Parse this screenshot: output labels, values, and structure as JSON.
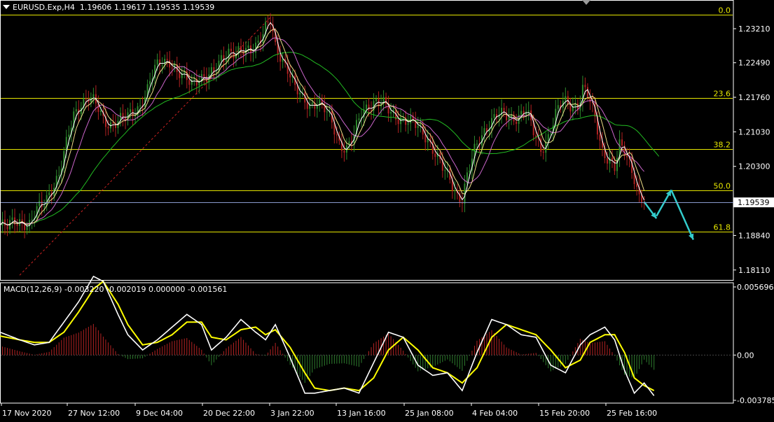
{
  "header": {
    "symbol": "EURUSD.Exp,H4",
    "ohlc": "1.19606 1.19617 1.19535 1.19539"
  },
  "macd_header": "MACD(12,26,9) -0.003220 -0.002019 0.000000 -0.001561",
  "colors": {
    "background": "#000000",
    "axis": "#ffffff",
    "fib": "#e6e600",
    "fib_label": "#e6e600",
    "bull": "#2e8b2e",
    "bear": "#b22222",
    "ma_fast": "#ffffff",
    "ma_mid": "#eedd88",
    "ma_slow": "#cc66cc",
    "ma_long": "#22bb22",
    "macd_line": "#ffffff",
    "signal_line": "#ffff00",
    "hist_pos": "#b22222",
    "hist_neg": "#2e7d2e",
    "arrow": "#33cccc",
    "price_marker_line": "#8899cc",
    "trend": "#cc2222"
  },
  "chart_data": [
    {
      "type": "line",
      "title": "EURUSD.Exp,H4",
      "price_ticks": [
        "1.23210",
        "1.22490",
        "1.21760",
        "1.21030",
        "1.20300",
        "1.19539",
        "1.18840",
        "1.18110"
      ],
      "price_tick_values": [
        1.2321,
        1.2249,
        1.2176,
        1.2103,
        1.203,
        1.19539,
        1.1884,
        1.1811
      ],
      "current_price": "1.19539",
      "x_labels": [
        "17 Nov 2020",
        "27 Nov 12:00",
        "9 Dec 04:00",
        "20 Dec 22:00",
        "3 Jan 22:00",
        "13 Jan 16:00",
        "25 Jan 08:00",
        "4 Feb 04:00",
        "15 Feb 20:00",
        "25 Feb 16:00"
      ],
      "fibonacci": [
        {
          "level": "0.0",
          "price": 1.235
        },
        {
          "level": "23.6",
          "price": 1.2175
        },
        {
          "level": "38.2",
          "price": 1.2067
        },
        {
          "level": "50.0",
          "price": 1.198
        },
        {
          "level": "61.8",
          "price": 1.1892
        }
      ],
      "price_path": [
        [
          0,
          1.1905
        ],
        [
          3,
          1.19
        ],
        [
          6,
          1.1915
        ],
        [
          9,
          1.1915
        ],
        [
          12,
          1.1905
        ],
        [
          15,
          1.1935
        ],
        [
          18,
          1.1955
        ],
        [
          21,
          1.1985
        ],
        [
          24,
          1.201
        ],
        [
          27,
          1.2075
        ],
        [
          30,
          1.214
        ],
        [
          33,
          1.2165
        ],
        [
          36,
          1.2175
        ],
        [
          39,
          1.216
        ],
        [
          42,
          1.213
        ],
        [
          45,
          1.212
        ],
        [
          48,
          1.2125
        ],
        [
          51,
          1.213
        ],
        [
          54,
          1.2145
        ],
        [
          57,
          1.216
        ],
        [
          60,
          1.219
        ],
        [
          63,
          1.2235
        ],
        [
          66,
          1.2255
        ],
        [
          69,
          1.2255
        ],
        [
          72,
          1.2225
        ],
        [
          75,
          1.2215
        ],
        [
          78,
          1.221
        ],
        [
          81,
          1.222
        ],
        [
          84,
          1.2215
        ],
        [
          87,
          1.2225
        ],
        [
          90,
          1.226
        ],
        [
          93,
          1.2275
        ],
        [
          96,
          1.2265
        ],
        [
          99,
          1.227
        ],
        [
          102,
          1.228
        ],
        [
          105,
          1.2295
        ],
        [
          108,
          1.232
        ],
        [
          110,
          1.2335
        ],
        [
          112,
          1.228
        ],
        [
          114,
          1.2265
        ],
        [
          117,
          1.224
        ],
        [
          120,
          1.2195
        ],
        [
          123,
          1.217
        ],
        [
          126,
          1.216
        ],
        [
          129,
          1.217
        ],
        [
          132,
          1.215
        ],
        [
          135,
          1.212
        ],
        [
          138,
          1.208
        ],
        [
          141,
          1.207
        ],
        [
          144,
          1.2095
        ],
        [
          147,
          1.214
        ],
        [
          150,
          1.216
        ],
        [
          153,
          1.217
        ],
        [
          156,
          1.216
        ],
        [
          159,
          1.214
        ],
        [
          162,
          1.2135
        ],
        [
          165,
          1.213
        ],
        [
          168,
          1.212
        ],
        [
          171,
          1.2105
        ],
        [
          174,
          1.209
        ],
        [
          177,
          1.206
        ],
        [
          180,
          1.2025
        ],
        [
          183,
          1.2
        ],
        [
          186,
          1.197
        ],
        [
          188,
          1.1965
        ],
        [
          190,
          1.201
        ],
        [
          193,
          1.206
        ],
        [
          196,
          1.2095
        ],
        [
          199,
          1.2125
        ],
        [
          202,
          1.214
        ],
        [
          205,
          1.2135
        ],
        [
          208,
          1.213
        ],
        [
          211,
          1.214
        ],
        [
          214,
          1.215
        ],
        [
          217,
          1.21
        ],
        [
          220,
          1.2065
        ],
        [
          223,
          1.2095
        ],
        [
          226,
          1.214
        ],
        [
          229,
          1.2165
        ],
        [
          232,
          1.216
        ],
        [
          235,
          1.216
        ],
        [
          237,
          1.2195
        ],
        [
          239,
          1.218
        ],
        [
          242,
          1.213
        ],
        [
          245,
          1.2065
        ],
        [
          248,
          1.2045
        ],
        [
          250,
          1.2025
        ],
        [
          252,
          1.207
        ],
        [
          254,
          1.206
        ],
        [
          256,
          1.204
        ],
        [
          258,
          1.201
        ],
        [
          260,
          1.1965
        ],
        [
          262,
          1.1955
        ]
      ],
      "projection_arrows": [
        [
          [
            262,
            1.1955
          ],
          [
            267,
            1.192
          ]
        ],
        [
          [
            267,
            1.1925
          ],
          [
            273,
            1.198
          ]
        ],
        [
          [
            273,
            1.198
          ],
          [
            282,
            1.1875
          ]
        ]
      ],
      "xlim": [
        0,
        298
      ],
      "ylim": [
        1.179,
        1.2355
      ]
    },
    {
      "type": "bar",
      "title": "MACD(12,26,9)",
      "y_ticks": [
        "0.005696",
        "0.00",
        "-0.003785"
      ],
      "y_tick_values": [
        0.005696,
        0.0,
        -0.003785
      ],
      "macd": [
        [
          0,
          0.0018
        ],
        [
          8,
          0.0012
        ],
        [
          14,
          0.0008
        ],
        [
          20,
          0.001
        ],
        [
          26,
          0.0026
        ],
        [
          32,
          0.0042
        ],
        [
          38,
          0.0062
        ],
        [
          42,
          0.0058
        ],
        [
          48,
          0.0032
        ],
        [
          52,
          0.0016
        ],
        [
          58,
          0.0004
        ],
        [
          64,
          0.0012
        ],
        [
          70,
          0.0022
        ],
        [
          76,
          0.0032
        ],
        [
          82,
          0.0024
        ],
        [
          86,
          0.0004
        ],
        [
          92,
          0.0014
        ],
        [
          98,
          0.0028
        ],
        [
          104,
          0.0018
        ],
        [
          108,
          0.0012
        ],
        [
          112,
          0.0024
        ],
        [
          118,
          -0.0002
        ],
        [
          124,
          -0.003
        ],
        [
          128,
          -0.003
        ],
        [
          134,
          -0.0028
        ],
        [
          140,
          -0.0026
        ],
        [
          146,
          -0.003
        ],
        [
          152,
          -0.0006
        ],
        [
          158,
          0.0018
        ],
        [
          164,
          0.0014
        ],
        [
          170,
          -0.0008
        ],
        [
          176,
          -0.0016
        ],
        [
          182,
          -0.0014
        ],
        [
          188,
          -0.0028
        ],
        [
          194,
          0.0002
        ],
        [
          200,
          0.0028
        ],
        [
          206,
          0.0024
        ],
        [
          212,
          0.0016
        ],
        [
          218,
          0.0014
        ],
        [
          224,
          -0.0008
        ],
        [
          230,
          -0.0014
        ],
        [
          236,
          0.0008
        ],
        [
          240,
          0.0016
        ],
        [
          246,
          0.0022
        ],
        [
          250,
          0.0012
        ],
        [
          254,
          -0.0012
        ],
        [
          258,
          -0.003
        ],
        [
          262,
          -0.0022
        ],
        [
          266,
          -0.0032
        ]
      ],
      "signal": [
        [
          0,
          0.0015
        ],
        [
          8,
          0.0012
        ],
        [
          14,
          0.001
        ],
        [
          20,
          0.001
        ],
        [
          26,
          0.0018
        ],
        [
          32,
          0.0034
        ],
        [
          38,
          0.0052
        ],
        [
          42,
          0.0058
        ],
        [
          48,
          0.004
        ],
        [
          52,
          0.0024
        ],
        [
          58,
          0.0008
        ],
        [
          64,
          0.001
        ],
        [
          70,
          0.0016
        ],
        [
          76,
          0.0026
        ],
        [
          82,
          0.0026
        ],
        [
          86,
          0.0014
        ],
        [
          92,
          0.0012
        ],
        [
          98,
          0.002
        ],
        [
          104,
          0.0022
        ],
        [
          108,
          0.0016
        ],
        [
          112,
          0.002
        ],
        [
          118,
          0.0006
        ],
        [
          124,
          -0.0014
        ],
        [
          128,
          -0.0026
        ],
        [
          134,
          -0.0028
        ],
        [
          140,
          -0.0026
        ],
        [
          146,
          -0.0028
        ],
        [
          152,
          -0.0018
        ],
        [
          158,
          0.0004
        ],
        [
          164,
          0.0014
        ],
        [
          170,
          0.0004
        ],
        [
          176,
          -0.001
        ],
        [
          182,
          -0.0014
        ],
        [
          188,
          -0.0022
        ],
        [
          194,
          -0.001
        ],
        [
          200,
          0.0014
        ],
        [
          206,
          0.0024
        ],
        [
          212,
          0.002
        ],
        [
          218,
          0.0016
        ],
        [
          224,
          0.0004
        ],
        [
          230,
          -0.001
        ],
        [
          236,
          -0.0004
        ],
        [
          240,
          0.001
        ],
        [
          246,
          0.0016
        ],
        [
          250,
          0.0016
        ],
        [
          254,
          0.0002
        ],
        [
          258,
          -0.0018
        ],
        [
          262,
          -0.0024
        ],
        [
          266,
          -0.0028
        ]
      ],
      "xlim": [
        0,
        298
      ],
      "ylim": [
        -0.003785,
        0.005696
      ]
    }
  ]
}
